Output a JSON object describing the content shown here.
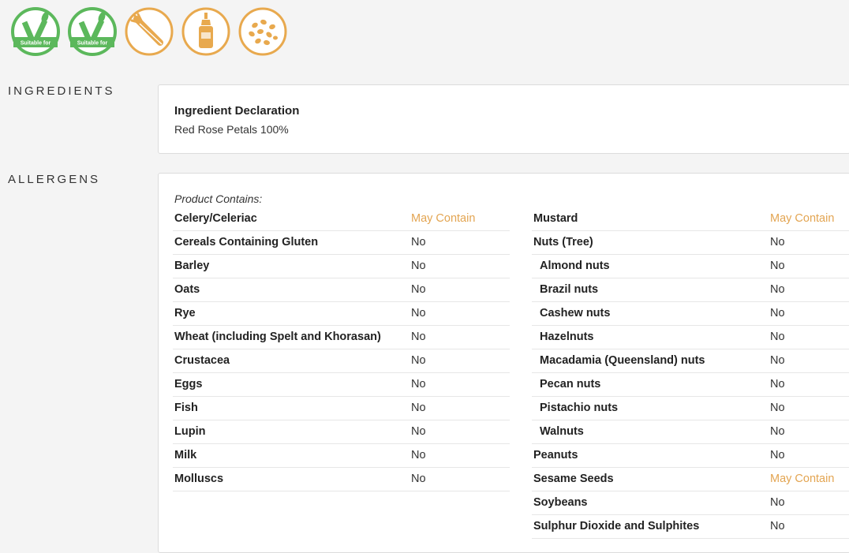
{
  "badges": [
    {
      "icon": "vegetarian-icon",
      "label": "Suitable for",
      "color": "#5cb85c"
    },
    {
      "icon": "vegan-icon",
      "label": "Suitable for",
      "color": "#5cb85c"
    },
    {
      "icon": "celery-icon",
      "color": "#e8a94e"
    },
    {
      "icon": "mustard-icon",
      "color": "#e8a94e"
    },
    {
      "icon": "sesame-icon",
      "color": "#e8a94e"
    }
  ],
  "ingredients": {
    "label": "INGREDIENTS",
    "title": "Ingredient Declaration",
    "text": "Red Rose Petals 100%"
  },
  "allergens": {
    "label": "ALLERGENS",
    "contains_label": "Product Contains:",
    "left": [
      {
        "name": "Celery/Celeriac",
        "value": "May Contain"
      },
      {
        "name": "Cereals Containing Gluten",
        "value": "No"
      },
      {
        "name": "Barley",
        "value": "No"
      },
      {
        "name": "Oats",
        "value": "No"
      },
      {
        "name": "Rye",
        "value": "No"
      },
      {
        "name": "Wheat (including Spelt and Khorasan)",
        "value": "No"
      },
      {
        "name": "Crustacea",
        "value": "No"
      },
      {
        "name": "Eggs",
        "value": "No"
      },
      {
        "name": "Fish",
        "value": "No"
      },
      {
        "name": "Lupin",
        "value": "No"
      },
      {
        "name": "Milk",
        "value": "No"
      },
      {
        "name": "Molluscs",
        "value": "No"
      }
    ],
    "right": [
      {
        "name": "Mustard",
        "value": "May Contain"
      },
      {
        "name": "Nuts (Tree)",
        "value": "No"
      },
      {
        "name": "Almond nuts",
        "value": "No"
      },
      {
        "name": "Brazil nuts",
        "value": "No"
      },
      {
        "name": "Cashew nuts",
        "value": "No"
      },
      {
        "name": "Hazelnuts",
        "value": "No"
      },
      {
        "name": "Macadamia (Queensland) nuts",
        "value": "No"
      },
      {
        "name": "Pecan nuts",
        "value": "No"
      },
      {
        "name": "Pistachio nuts",
        "value": "No"
      },
      {
        "name": "Walnuts",
        "value": "No"
      },
      {
        "name": "Peanuts",
        "value": "No"
      },
      {
        "name": "Sesame Seeds",
        "value": "May Contain"
      },
      {
        "name": "Soybeans",
        "value": "No"
      },
      {
        "name": "Sulphur Dioxide and Sulphites",
        "value": "No"
      }
    ],
    "may_color": "#e3a552"
  }
}
